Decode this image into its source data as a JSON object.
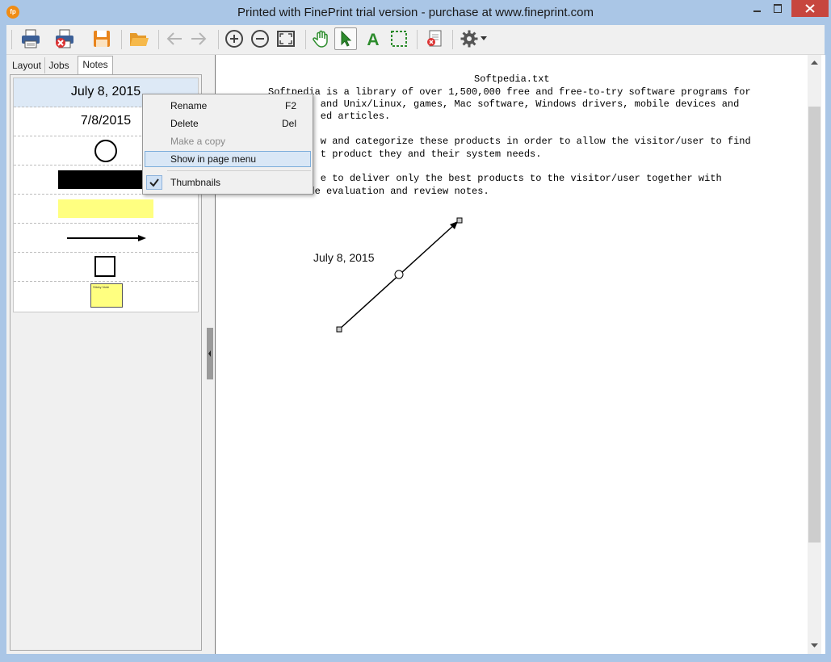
{
  "window": {
    "title": "Printed with FinePrint trial version - purchase at www.fineprint.com",
    "logo_text": "fp"
  },
  "toolbar": {
    "buttons": [
      "print",
      "delete-job",
      "save",
      "open",
      "back",
      "forward",
      "zoom-in",
      "zoom-out",
      "fit-page",
      "hand-tool",
      "select-tool",
      "text-tool",
      "region-select",
      "delete-notes",
      "settings"
    ]
  },
  "tabs": [
    {
      "label": "Layout"
    },
    {
      "label": "Jobs"
    },
    {
      "label": "Notes"
    }
  ],
  "notes": [
    {
      "type": "text",
      "text": "July 8, 2015"
    },
    {
      "type": "text",
      "text": "7/8/2015"
    },
    {
      "type": "circle"
    },
    {
      "type": "black-bar"
    },
    {
      "type": "highlight"
    },
    {
      "type": "arrow"
    },
    {
      "type": "square"
    },
    {
      "type": "sticky",
      "text": "Sticky Note"
    }
  ],
  "context_menu": {
    "items": [
      {
        "label": "Rename",
        "shortcut": "F2"
      },
      {
        "label": "Delete",
        "shortcut": "Del"
      },
      {
        "label": "Make a copy",
        "shortcut": ""
      },
      {
        "label": "Show in page menu",
        "shortcut": ""
      },
      {
        "label": "Thumbnails",
        "shortcut": ""
      }
    ]
  },
  "document": {
    "title": "Softpedia.txt",
    "lines": [
      "Softpedia is a library of over 1,500,000 free and free-to-try software programs for",
      "         and Unix/Linux, games, Mac software, Windows drivers, mobile devices and",
      "         ed articles.",
      "",
      "         w and categorize these products in order to allow the visitor/user to find",
      "         t product they and their system needs.",
      "",
      "         e to deliver only the best products to the visitor/user together with",
      "self-made evaluation and review notes."
    ],
    "note_text": "July 8, 2015"
  },
  "colors": {
    "titlebar": "#aac6e6",
    "close_button": "#c7463e",
    "highlight": "#ffff80",
    "sticky": "#ffff80",
    "selection": "#dde9f6"
  }
}
